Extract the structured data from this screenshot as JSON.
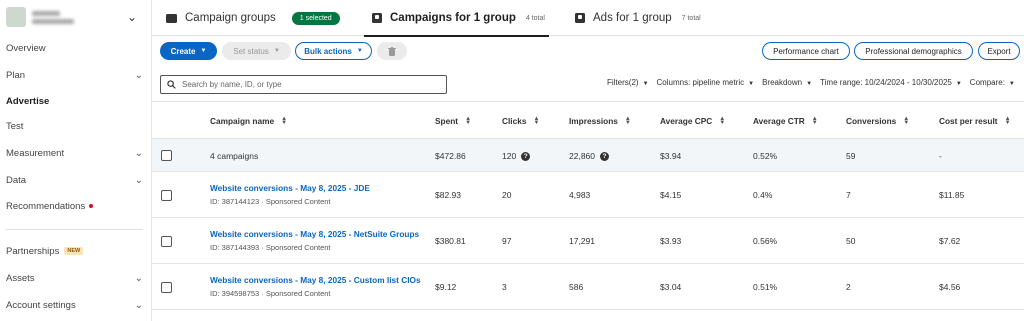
{
  "sidebar": {
    "items": [
      {
        "label": "Overview",
        "has_chevron": false
      },
      {
        "label": "Plan",
        "has_chevron": true
      },
      {
        "label": "Advertise",
        "has_chevron": false,
        "active": true
      },
      {
        "label": "Test",
        "has_chevron": false
      },
      {
        "label": "Measurement",
        "has_chevron": true
      },
      {
        "label": "Data",
        "has_chevron": true
      },
      {
        "label": "Recommendations",
        "has_chevron": false,
        "dot": true
      },
      {
        "label": "Partnerships",
        "has_chevron": false,
        "badge": "NEW"
      },
      {
        "label": "Assets",
        "has_chevron": true
      },
      {
        "label": "Account settings",
        "has_chevron": true
      }
    ]
  },
  "tabs": {
    "campaign_groups": {
      "label": "Campaign groups",
      "badge": "1 selected"
    },
    "campaigns": {
      "label": "Campaigns for 1 group",
      "count": "4 total"
    },
    "ads": {
      "label": "Ads for 1 group",
      "count": "7 total"
    }
  },
  "toolbar": {
    "create": "Create",
    "set_status": "Set status",
    "bulk_actions": "Bulk actions",
    "performance_chart": "Performance chart",
    "professional_demographics": "Professional demographics",
    "export": "Export"
  },
  "search": {
    "placeholder": "Search by name, ID, or type"
  },
  "filters": {
    "filters": "Filters(2)",
    "columns": "Columns: pipeline metric",
    "breakdown": "Breakdown",
    "time_range": "Time range: 10/24/2024 - 10/30/2025",
    "compare": "Compare:"
  },
  "table": {
    "headers": {
      "name": "Campaign name",
      "spent": "Spent",
      "clicks": "Clicks",
      "impressions": "Impressions",
      "avg_cpc": "Average CPC",
      "avg_ctr": "Average CTR",
      "conversions": "Conversions",
      "cost_per_result": "Cost per result"
    },
    "summary": {
      "name": "4 campaigns",
      "spent": "$472.86",
      "clicks": "120",
      "impressions": "22,860",
      "avg_cpc": "$3.94",
      "avg_ctr": "0.52%",
      "conversions": "59",
      "cost_per_result": "-"
    },
    "rows": [
      {
        "name": "Website conversions - May 8, 2025 - JDE",
        "sub": "ID: 387144123 · Sponsored Content",
        "spent": "$82.93",
        "clicks": "20",
        "impressions": "4,983",
        "avg_cpc": "$4.15",
        "avg_ctr": "0.4%",
        "conversions": "7",
        "cost_per_result": "$11.85"
      },
      {
        "name": "Website conversions - May 8, 2025 - NetSuite Groups",
        "sub": "ID: 387144393 · Sponsored Content",
        "spent": "$380.81",
        "clicks": "97",
        "impressions": "17,291",
        "avg_cpc": "$3.93",
        "avg_ctr": "0.56%",
        "conversions": "50",
        "cost_per_result": "$7.62"
      },
      {
        "name": "Website conversions - May 8, 2025 - Custom list CIOs",
        "sub": "ID: 394598753 · Sponsored Content",
        "spent": "$9.12",
        "clicks": "3",
        "impressions": "586",
        "avg_cpc": "$3.04",
        "avg_ctr": "0.51%",
        "conversions": "2",
        "cost_per_result": "$4.56"
      }
    ]
  }
}
